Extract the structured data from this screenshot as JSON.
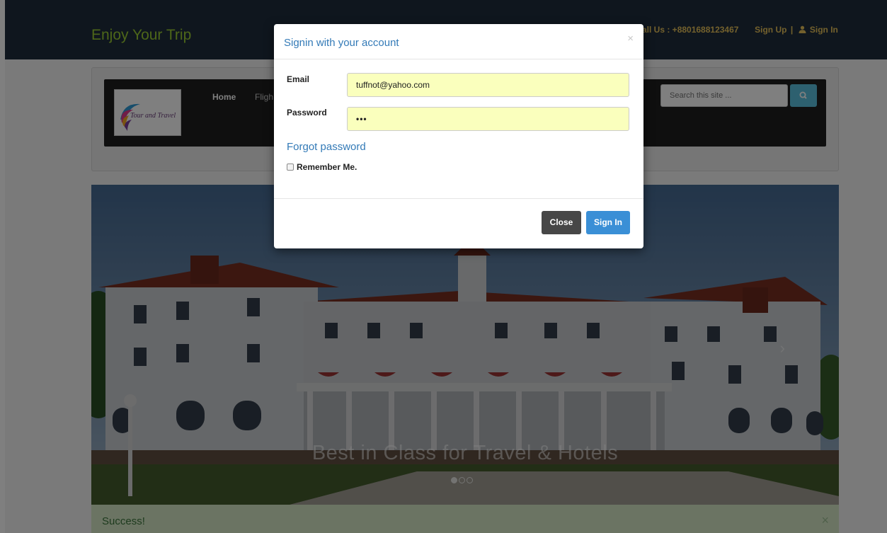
{
  "header": {
    "brand": "Enjoy Your Trip",
    "call": "all Us : +8801688123467",
    "sign_up": "Sign Up",
    "divider": "|",
    "sign_in": "Sign In"
  },
  "logo": {
    "text": "Tour and Travel"
  },
  "nav": {
    "home": "Home",
    "flights_partial": "Fligh"
  },
  "search": {
    "placeholder": "Search this site ..."
  },
  "hero": {
    "caption": "Best in Class for Travel & Hotels",
    "slide_count": 3,
    "active_slide": 1
  },
  "alert": {
    "message": "Success!",
    "close": "×"
  },
  "modal": {
    "title": "Signin with your account",
    "close_symbol": "×",
    "email_label": "Email",
    "email_value": "tuffnot@yahoo.com",
    "password_label": "Password",
    "password_value": "•••",
    "forgot": "Forgot password",
    "remember": "Remember Me.",
    "close_button": "Close",
    "signin_button": "Sign In"
  },
  "colors": {
    "navbar": "#1f2d3d",
    "brand": "#9acd32",
    "accent_link": "#337ab7",
    "primary_button": "#3a8fd6",
    "search_button": "#5bc0de",
    "autofill": "#faffbd"
  }
}
